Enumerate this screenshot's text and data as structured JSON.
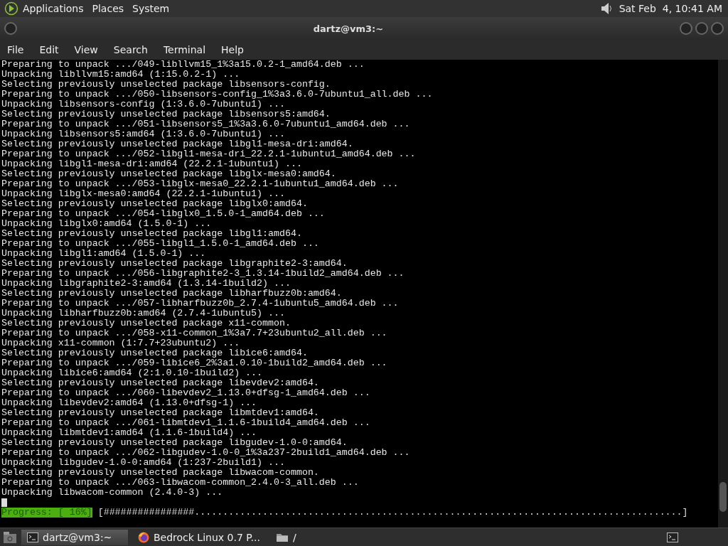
{
  "top_panel": {
    "menus": [
      "Applications",
      "Places",
      "System"
    ],
    "clock": "Sat Feb  4, 10:41 AM"
  },
  "window": {
    "title": "dartz@vm3:~"
  },
  "menu_bar": [
    "File",
    "Edit",
    "View",
    "Search",
    "Terminal",
    "Help"
  ],
  "terminal": {
    "lines": [
      "Preparing to unpack .../049-libllvm15_1%3a15.0.2-1_amd64.deb ...",
      "Unpacking libllvm15:amd64 (1:15.0.2-1) ...",
      "Selecting previously unselected package libsensors-config.",
      "Preparing to unpack .../050-libsensors-config_1%3a3.6.0-7ubuntu1_all.deb ...",
      "Unpacking libsensors-config (1:3.6.0-7ubuntu1) ...",
      "Selecting previously unselected package libsensors5:amd64.",
      "Preparing to unpack .../051-libsensors5_1%3a3.6.0-7ubuntu1_amd64.deb ...",
      "Unpacking libsensors5:amd64 (1:3.6.0-7ubuntu1) ...",
      "Selecting previously unselected package libgl1-mesa-dri:amd64.",
      "Preparing to unpack .../052-libgl1-mesa-dri_22.2.1-1ubuntu1_amd64.deb ...",
      "Unpacking libgl1-mesa-dri:amd64 (22.2.1-1ubuntu1) ...",
      "Selecting previously unselected package libglx-mesa0:amd64.",
      "Preparing to unpack .../053-libglx-mesa0_22.2.1-1ubuntu1_amd64.deb ...",
      "Unpacking libglx-mesa0:amd64 (22.2.1-1ubuntu1) ...",
      "Selecting previously unselected package libglx0:amd64.",
      "Preparing to unpack .../054-libglx0_1.5.0-1_amd64.deb ...",
      "Unpacking libglx0:amd64 (1.5.0-1) ...",
      "Selecting previously unselected package libgl1:amd64.",
      "Preparing to unpack .../055-libgl1_1.5.0-1_amd64.deb ...",
      "Unpacking libgl1:amd64 (1.5.0-1) ...",
      "Selecting previously unselected package libgraphite2-3:amd64.",
      "Preparing to unpack .../056-libgraphite2-3_1.3.14-1build2_amd64.deb ...",
      "Unpacking libgraphite2-3:amd64 (1.3.14-1build2) ...",
      "Selecting previously unselected package libharfbuzz0b:amd64.",
      "Preparing to unpack .../057-libharfbuzz0b_2.7.4-1ubuntu5_amd64.deb ...",
      "Unpacking libharfbuzz0b:amd64 (2.7.4-1ubuntu5) ...",
      "Selecting previously unselected package x11-common.",
      "Preparing to unpack .../058-x11-common_1%3a7.7+23ubuntu2_all.deb ...",
      "Unpacking x11-common (1:7.7+23ubuntu2) ...",
      "Selecting previously unselected package libice6:amd64.",
      "Preparing to unpack .../059-libice6_2%3a1.0.10-1build2_amd64.deb ...",
      "Unpacking libice6:amd64 (2:1.0.10-1build2) ...",
      "Selecting previously unselected package libevdev2:amd64.",
      "Preparing to unpack .../060-libevdev2_1.13.0+dfsg-1_amd64.deb ...",
      "Unpacking libevdev2:amd64 (1.13.0+dfsg-1) ...",
      "Selecting previously unselected package libmtdev1:amd64.",
      "Preparing to unpack .../061-libmtdev1_1.1.6-1build4_amd64.deb ...",
      "Unpacking libmtdev1:amd64 (1.1.6-1build4) ...",
      "Selecting previously unselected package libgudev-1.0-0:amd64.",
      "Preparing to unpack .../062-libgudev-1.0-0_1%3a237-2build1_amd64.deb ...",
      "Unpacking libgudev-1.0-0:amd64 (1:237-2build1) ...",
      "Selecting previously unselected package libwacom-common.",
      "Preparing to unpack .../063-libwacom-common_2.4.0-3_all.deb ...",
      "Unpacking libwacom-common (2.4.0-3) ..."
    ],
    "progress_label": "Progress: [ 16%]",
    "progress_bar": "[################......................................................................................]"
  },
  "taskbar": {
    "items": [
      {
        "kind": "terminal",
        "label": "dartz@vm3:~",
        "selected": true
      },
      {
        "kind": "browser",
        "label": "Bedrock Linux 0.7 P...",
        "selected": false
      },
      {
        "kind": "folder",
        "label": "/",
        "selected": false
      }
    ]
  }
}
